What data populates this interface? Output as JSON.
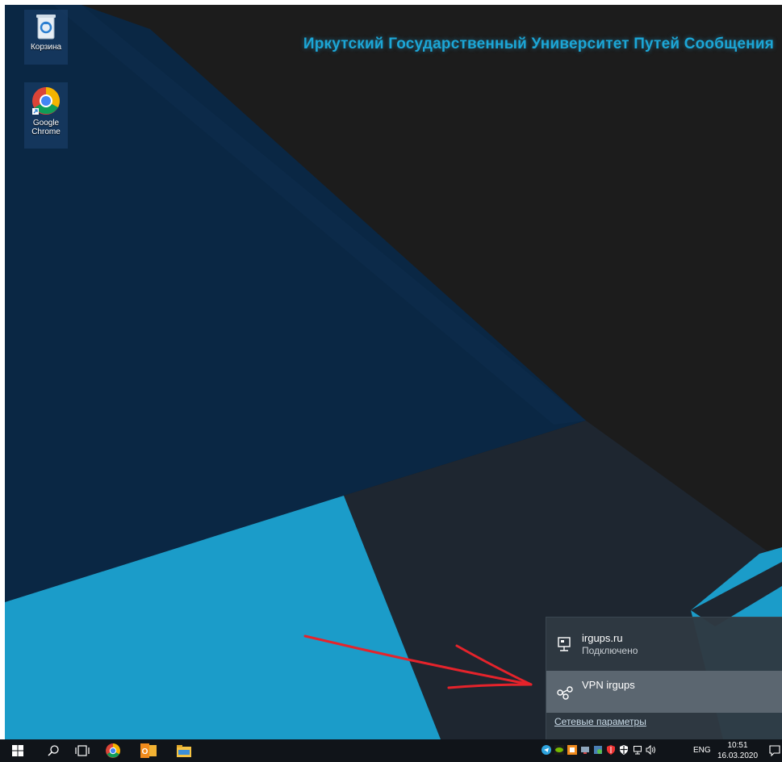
{
  "desktop": {
    "banner": "Иркутский Государственный Университет Путей Сообщения",
    "icons": [
      {
        "label": "Корзина",
        "icon": "recycle-bin-icon"
      },
      {
        "label_line1": "Google",
        "label_line2": "Chrome",
        "icon": "chrome-icon"
      }
    ]
  },
  "network_flyout": {
    "items": [
      {
        "name": "irgups.ru",
        "status": "Подключено",
        "icon": "ethernet-icon"
      },
      {
        "name": "VPN irgups",
        "icon": "vpn-icon"
      }
    ],
    "settings_link": "Сетевые параметры"
  },
  "taskbar": {
    "buttons": [
      "start-icon",
      "search-icon",
      "task-view-icon",
      "chrome-icon",
      "outlook-icon",
      "file-explorer-icon"
    ],
    "tray": {
      "language": "ENG",
      "time": "10:51",
      "date": "16.03.2020"
    }
  },
  "colors": {
    "banner": "#1ca6d6",
    "wallpaper_dark": "#1c1c1c",
    "wallpaper_navy": "#0a2744",
    "wallpaper_cyan": "#1b9cc9",
    "flyout_bg": "#2f3942",
    "taskbar": "#101419",
    "annotation_arrow": "#e5232b"
  }
}
